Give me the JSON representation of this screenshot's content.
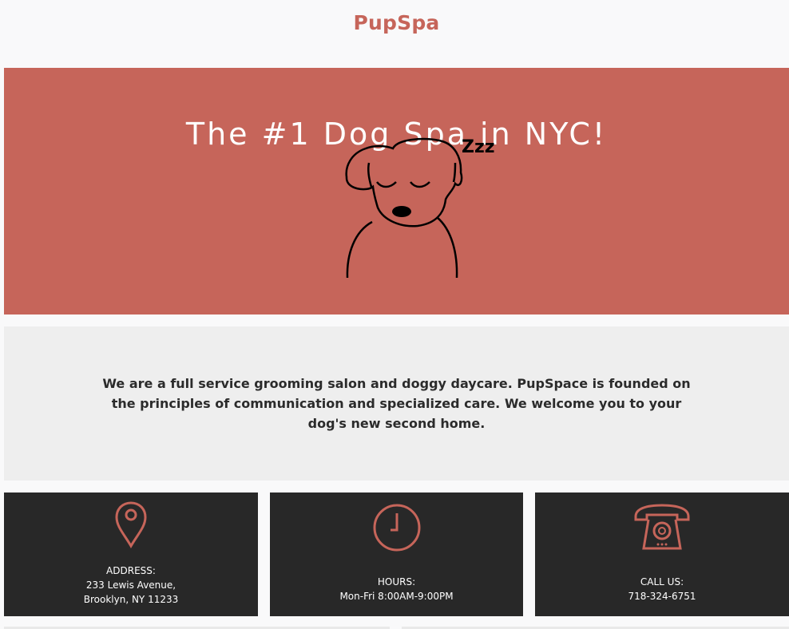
{
  "header": {
    "brand": "PupSpa"
  },
  "hero": {
    "title": "The #1 Dog Spa in NYC!",
    "snore": "Zzz",
    "background": "#c6655a"
  },
  "intro": {
    "text": "We are a full service grooming salon and doggy daycare. PupSpace is founded on the principles of communication and specialized care. We welcome you to your dog's new second home."
  },
  "info_cards": [
    {
      "icon": "map-pin-icon",
      "label": "ADDRESS:",
      "lines": [
        "233 Lewis Avenue,",
        "Brooklyn, NY 11233"
      ]
    },
    {
      "icon": "clock-icon",
      "label": "HOURS:",
      "lines": [
        "Mon-Fri 8:00AM-9:00PM"
      ]
    },
    {
      "icon": "telephone-icon",
      "label": "CALL US:",
      "lines": [
        "718-324-6751"
      ]
    }
  ],
  "colors": {
    "accent": "#c6655a",
    "card_bg": "#282828",
    "intro_bg": "#eeeeee",
    "page_bg": "#f9f9fa"
  }
}
